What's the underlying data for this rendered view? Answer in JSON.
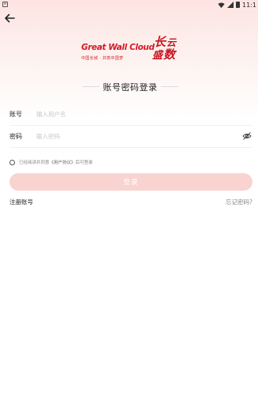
{
  "status_bar": {
    "app_icon_glyph": "A",
    "time": "11:1",
    "icons": [
      "wifi-icon",
      "signal-icon",
      "battery-icon"
    ]
  },
  "header": {
    "back_icon": "arrow-left-icon"
  },
  "logo": {
    "brand": "Great Wall Cloud",
    "slogan": "中国长城 · 共筑中国梦",
    "calligraphy": [
      "长",
      "云",
      "数",
      "盛"
    ]
  },
  "page_title": "账号密码登录",
  "account": {
    "label": "账号",
    "placeholder": "输入用户名",
    "value": ""
  },
  "password": {
    "label": "密码",
    "placeholder": "输入密码",
    "value": "",
    "toggle_icon": "eye-off-icon"
  },
  "agreement": {
    "prefix": "已经阅读并同意",
    "link": "《用户协议》",
    "suffix": "后可登录",
    "checked": false
  },
  "login_button_label": "登录",
  "register_label": "注册账号",
  "forgot_label": "忘记密码?",
  "colors": {
    "brand_red": "#d11c26",
    "button_disabled": "#f9d3d0",
    "header_gradient": "#fde4e2"
  }
}
